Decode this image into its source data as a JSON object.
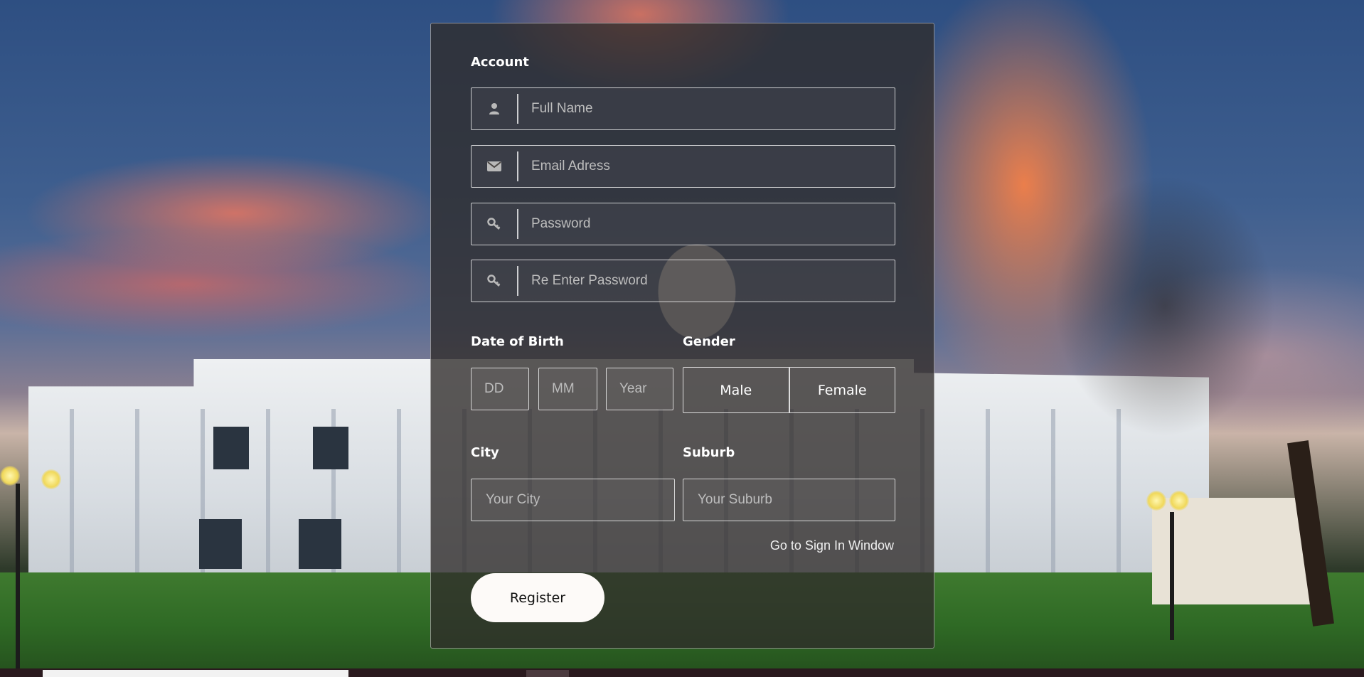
{
  "form": {
    "account_title": "Account",
    "full_name_placeholder": "Full Name",
    "email_placeholder": "Email Adress",
    "password_placeholder": "Password",
    "reenter_password_placeholder": "Re Enter Password",
    "dob_title": "Date of Birth",
    "dob_day_placeholder": "DD",
    "dob_month_placeholder": "MM",
    "dob_year_placeholder": "Year",
    "gender_title": "Gender",
    "gender_male": "Male",
    "gender_female": "Female",
    "city_title": "City",
    "city_placeholder": "Your City",
    "suburb_title": "Suburb",
    "suburb_placeholder": "Your Suburb",
    "signin_link": "Go to Sign In Window",
    "register_label": "Register"
  },
  "icons": {
    "full_name": "user-icon",
    "email": "envelope-icon",
    "password": "key-icon",
    "reenter_password": "key-icon"
  },
  "colors": {
    "panel_background": "#302c2a",
    "button_background": "#fdfaf8",
    "field_border": "#ffffff"
  }
}
